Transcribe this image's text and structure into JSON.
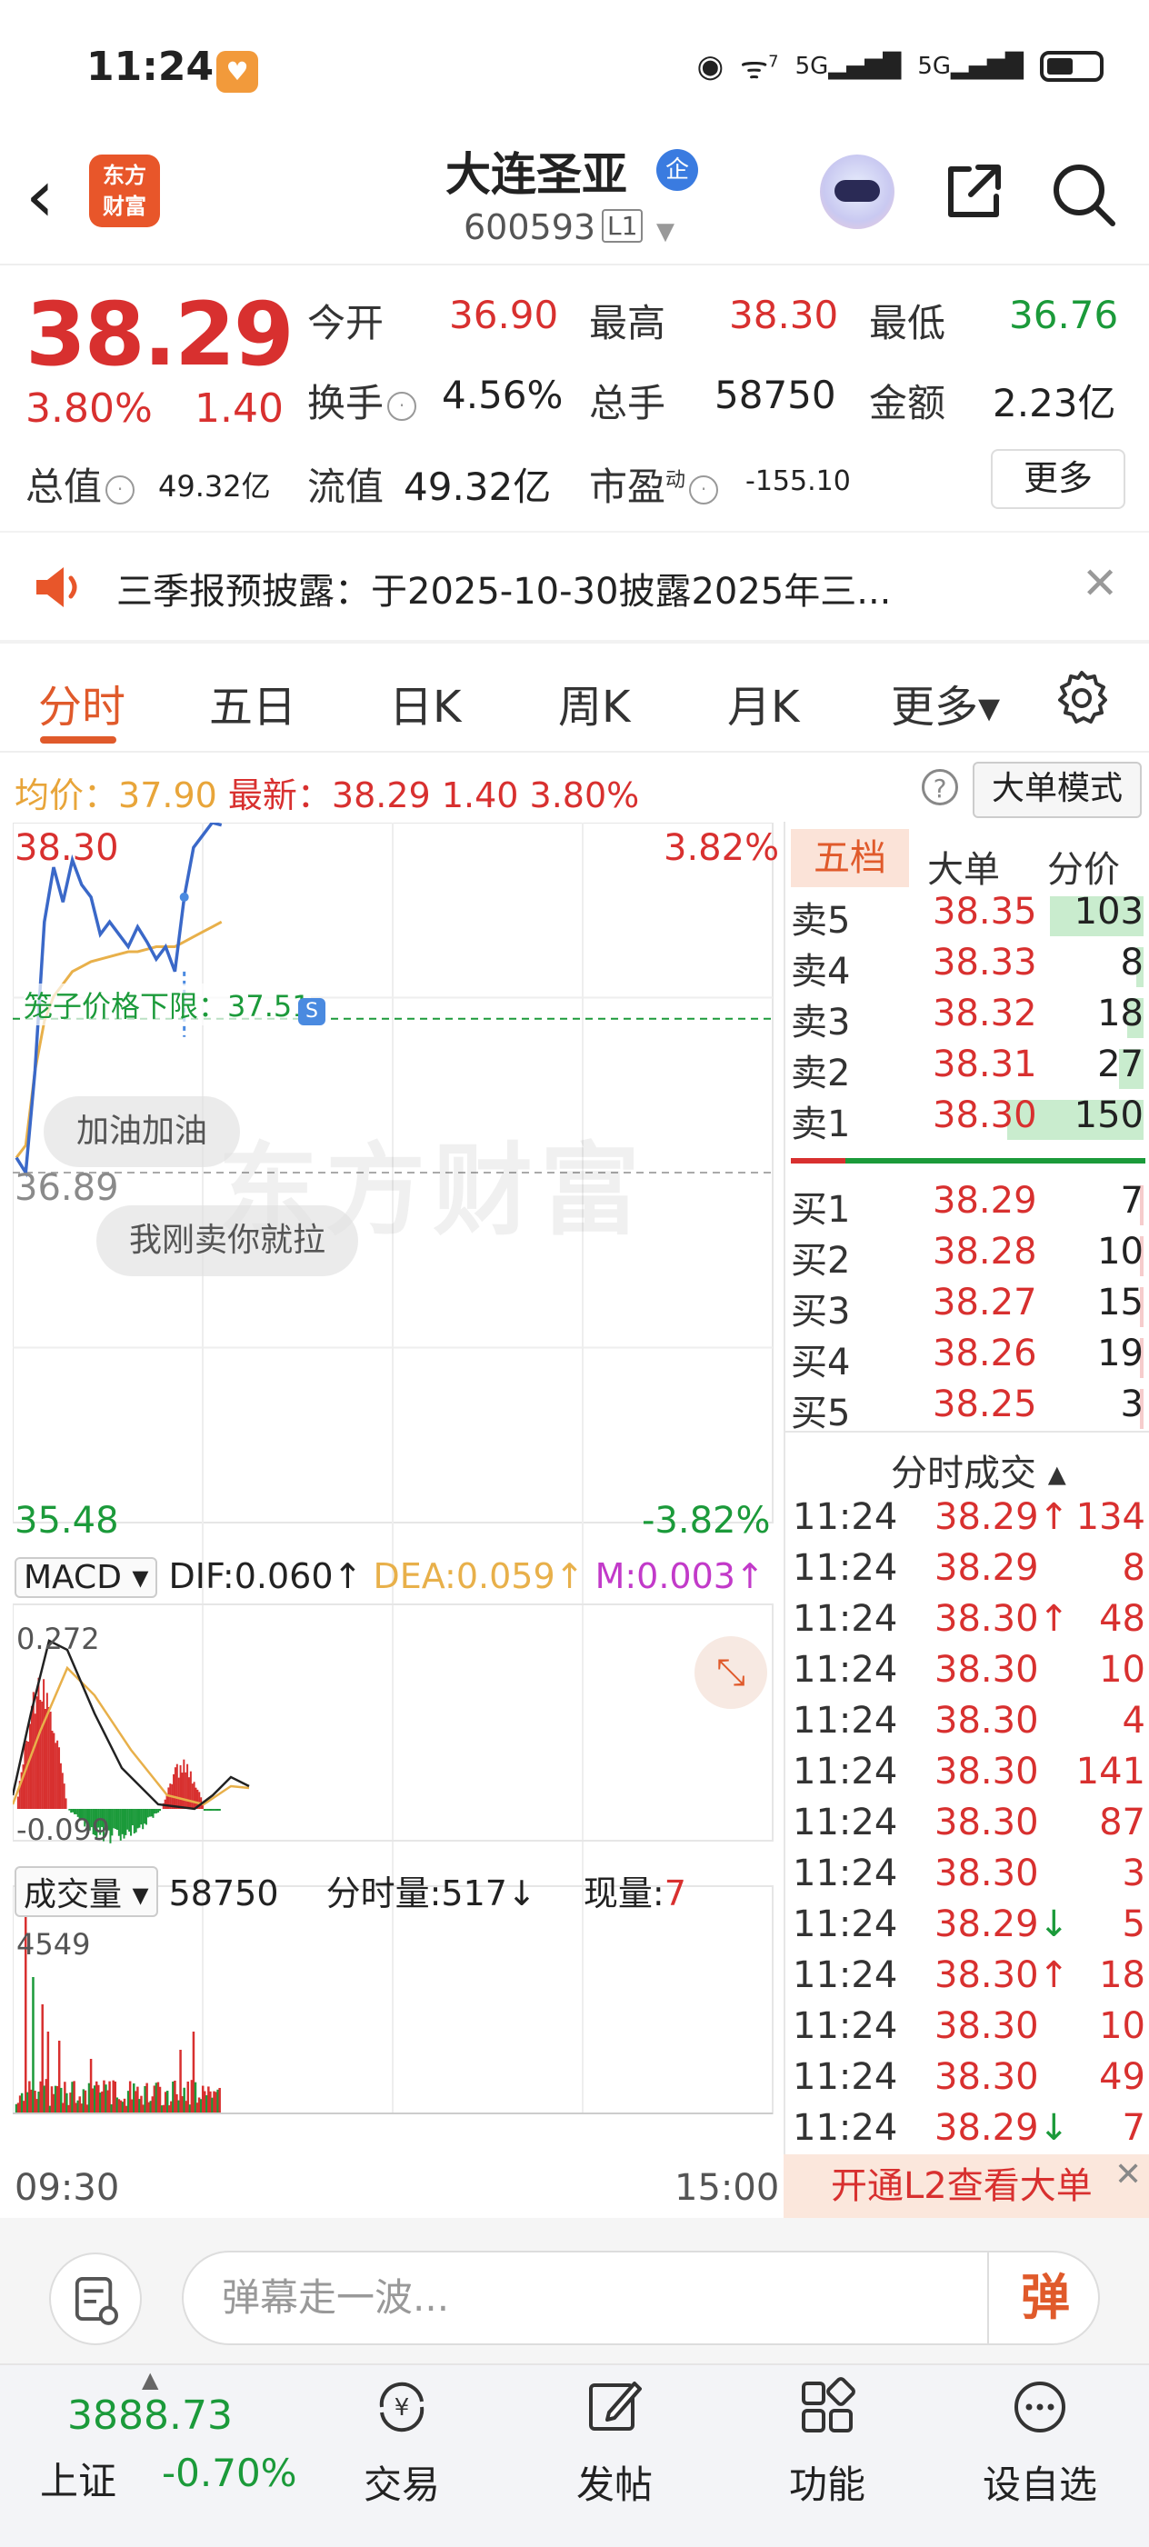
{
  "status": {
    "time": "11:24",
    "network": "5G",
    "wifi_badge": "7"
  },
  "header": {
    "logo_text_line1": "东方",
    "logo_text_line2": "财富",
    "stock_name": "大连圣亚",
    "badge": "企",
    "stock_code": "600593",
    "level": "L1"
  },
  "quote": {
    "price": "38.29",
    "change_pct": "3.80%",
    "change_amt": "1.40",
    "open_label": "今开",
    "open": "36.90",
    "high_label": "最高",
    "high": "38.30",
    "low_label": "最低",
    "low": "36.76",
    "turnover_label": "换手",
    "turnover": "4.56%",
    "volume_label": "总手",
    "volume": "58750",
    "amount_label": "金额",
    "amount": "2.23亿",
    "mktcap_label": "总值",
    "mktcap": "49.32亿",
    "float_label": "流值",
    "float_cap": "49.32亿",
    "pe_label": "市盈",
    "pe_sup": "动",
    "pe": "-155.10",
    "more": "更多"
  },
  "notice": {
    "text": "三季报预披露：于2025-10-30披露2025年三..."
  },
  "tabs": [
    {
      "label": "分时",
      "active": true
    },
    {
      "label": "五日"
    },
    {
      "label": "日K"
    },
    {
      "label": "周K"
    },
    {
      "label": "月K"
    },
    {
      "label": "更多▾"
    }
  ],
  "info_line": {
    "avg_label": "均价：",
    "avg": "37.90",
    "latest_label": "最新：",
    "latest": "38.29",
    "chg": "1.40",
    "pct": "3.80%",
    "mode_button": "大单模式"
  },
  "chart": {
    "top_price": "38.30",
    "top_pct": "3.82%",
    "mid_price": "36.89",
    "bottom_price": "35.48",
    "bottom_pct": "-3.82%",
    "cage_label": "笼子价格下限：37.51",
    "s_marker": "S",
    "danmu": [
      "加油加油",
      "我刚卖你就拉"
    ],
    "watermark": "东方财富",
    "time_start": "09:30",
    "time_end": "15:00"
  },
  "chart_data": {
    "type": "line",
    "title": "",
    "ylim": [
      35.48,
      38.3
    ],
    "pct_range": [
      "-3.82%",
      "3.82%"
    ],
    "prev_close": "36.89",
    "series": [
      {
        "name": "最新",
        "values": [
          36.95,
          36.89,
          37.3,
          37.9,
          38.12,
          37.98,
          38.15,
          38.05,
          38.0,
          37.85,
          37.9,
          37.85,
          37.8,
          37.88,
          37.82,
          37.75,
          37.8,
          37.7,
          38.0,
          38.2,
          38.25,
          38.3,
          38.29
        ]
      },
      {
        "name": "均价",
        "values": [
          36.95,
          37.0,
          37.3,
          37.5,
          37.6,
          37.65,
          37.7,
          37.72,
          37.74,
          37.75,
          37.76,
          37.77,
          37.78,
          37.78,
          37.79,
          37.8,
          37.8,
          37.8,
          37.82,
          37.84,
          37.86,
          37.88,
          37.9
        ]
      }
    ],
    "macd": {
      "dif": "0.060",
      "dea": "0.059",
      "m": "0.003",
      "ymax": "0.272",
      "ymin": "-0.099"
    },
    "volume": {
      "total": "58750",
      "minute_vol": "517",
      "current_vol": "7",
      "ymax": "4549"
    }
  },
  "macd_row": {
    "select": "MACD",
    "dif_label": "DIF:0.060↑",
    "dea_label": "DEA:0.059↑",
    "m_label": "M:0.003↑"
  },
  "volume_row": {
    "select": "成交量",
    "total": "58750",
    "minute_label": "分时量:517↓",
    "current_label": "现量:",
    "current": "7"
  },
  "orderbook": {
    "tabs": [
      "五档",
      "大单",
      "分价"
    ],
    "sells": [
      {
        "label": "卖5",
        "price": "38.35",
        "vol": "103"
      },
      {
        "label": "卖4",
        "price": "38.33",
        "vol": "8"
      },
      {
        "label": "卖3",
        "price": "38.32",
        "vol": "18"
      },
      {
        "label": "卖2",
        "price": "38.31",
        "vol": "27"
      },
      {
        "label": "卖1",
        "price": "38.30",
        "vol": "150"
      }
    ],
    "buys": [
      {
        "label": "买1",
        "price": "38.29",
        "vol": "7"
      },
      {
        "label": "买2",
        "price": "38.28",
        "vol": "10"
      },
      {
        "label": "买3",
        "price": "38.27",
        "vol": "15"
      },
      {
        "label": "买4",
        "price": "38.26",
        "vol": "19"
      },
      {
        "label": "买5",
        "price": "38.25",
        "vol": "3"
      }
    ],
    "trades_title": "分时成交 ▴",
    "trades": [
      {
        "time": "11:24",
        "price": "38.29↑",
        "vol": "134"
      },
      {
        "time": "11:24",
        "price": "38.29",
        "vol": "8"
      },
      {
        "time": "11:24",
        "price": "38.30↑",
        "vol": "48"
      },
      {
        "time": "11:24",
        "price": "38.30",
        "vol": "10"
      },
      {
        "time": "11:24",
        "price": "38.30",
        "vol": "4"
      },
      {
        "time": "11:24",
        "price": "38.30",
        "vol": "141"
      },
      {
        "time": "11:24",
        "price": "38.30",
        "vol": "87"
      },
      {
        "time": "11:24",
        "price": "38.30",
        "vol": "3"
      },
      {
        "time": "11:24",
        "price": "38.29↓",
        "vol": "5"
      },
      {
        "time": "11:24",
        "price": "38.30↑",
        "vol": "18"
      },
      {
        "time": "11:24",
        "price": "38.30",
        "vol": "10"
      },
      {
        "time": "11:24",
        "price": "38.30",
        "vol": "49"
      },
      {
        "time": "11:24",
        "price": "38.29↓",
        "vol": "7"
      }
    ],
    "l2_banner": "开通L2查看大单"
  },
  "danmu_input": {
    "placeholder": "弹幕走一波...",
    "send": "弹"
  },
  "bottom_nav": {
    "index_value": "3888.73",
    "index_name": "上证",
    "index_change": "-0.70%",
    "items": [
      {
        "label": "交易",
        "icon": "trade-icon"
      },
      {
        "label": "发帖",
        "icon": "edit-icon"
      },
      {
        "label": "功能",
        "icon": "grid-icon"
      },
      {
        "label": "设自选",
        "icon": "more-icon"
      }
    ]
  },
  "colors": {
    "up": "#d8302f",
    "down": "#1b9a3a",
    "accent": "#e05a2b",
    "avg_line": "#e8b04a"
  }
}
